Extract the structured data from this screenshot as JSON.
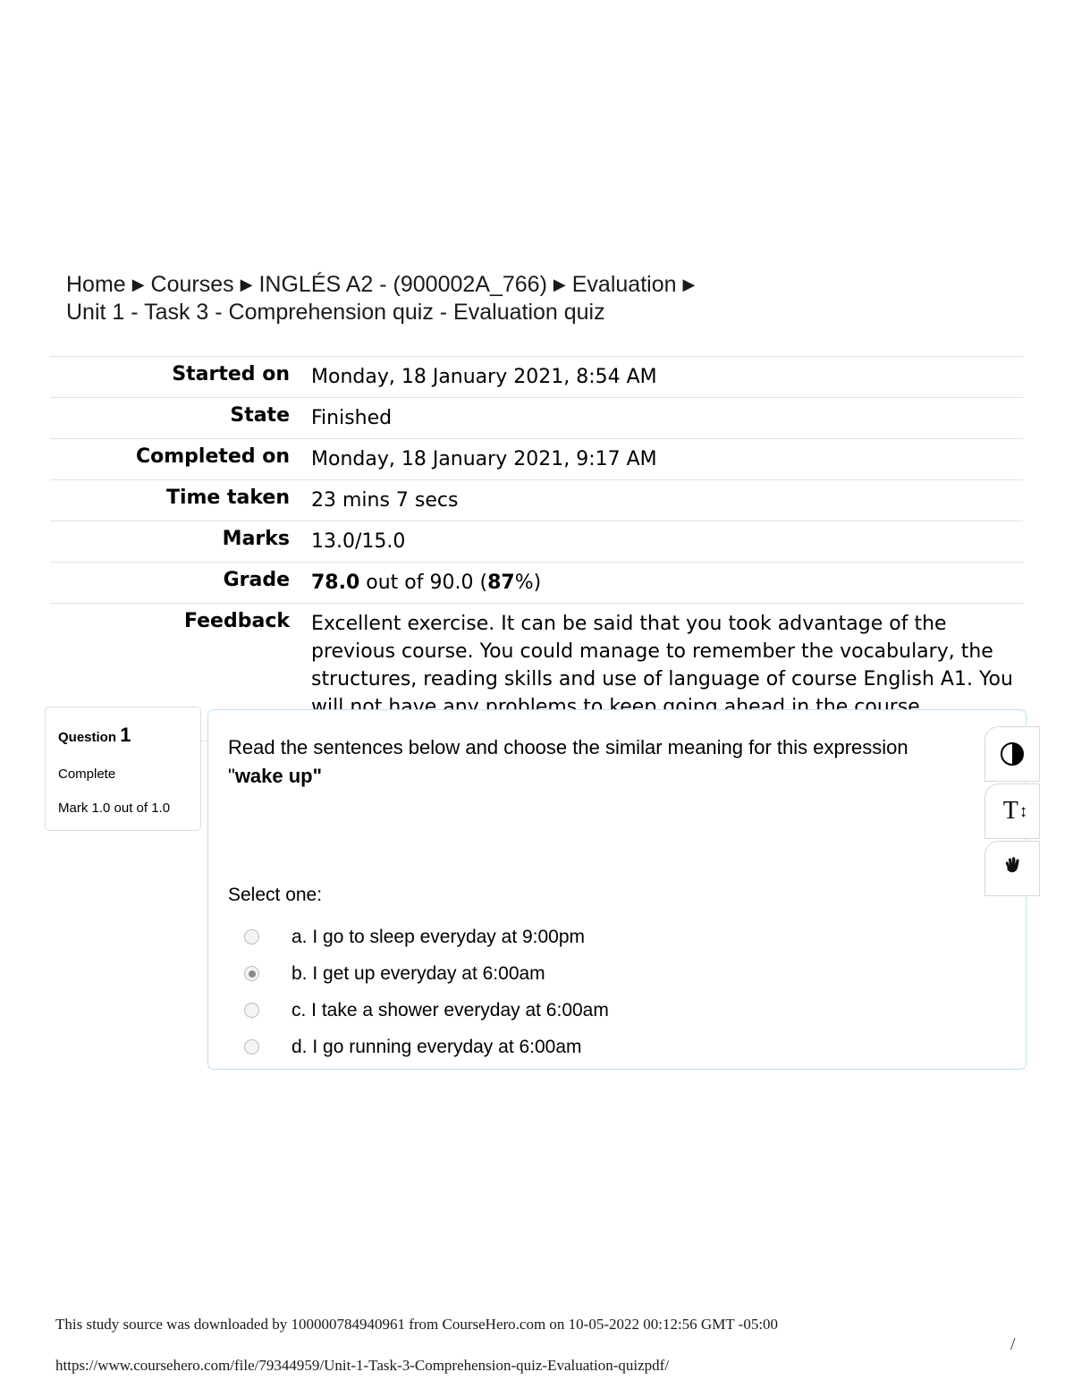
{
  "breadcrumb": {
    "separator": "▶",
    "items": [
      "Home",
      "Courses",
      "INGLÉS A2 - (900002A_766)",
      "Evaluation",
      "Unit 1 - Task 3 - Comprehension quiz - Evaluation quiz"
    ]
  },
  "summary": {
    "rows": [
      {
        "label": "Started on",
        "value": "Monday, 18 January 2021, 8:54 AM"
      },
      {
        "label": "State",
        "value": "Finished"
      },
      {
        "label": "Completed on",
        "value": "Monday, 18 January 2021, 9:17 AM"
      },
      {
        "label": "Time taken",
        "value": "23 mins 7 secs"
      },
      {
        "label": "Marks",
        "value": "13.0/15.0"
      }
    ],
    "grade": {
      "label": "Grade",
      "score": "78.0",
      "middle": " out of 90.0 (",
      "percent": "87",
      "suffix": "%)"
    },
    "feedback": {
      "label": "Feedback",
      "value": "Excellent exercise. It can be said that you took advantage of the previous course. You could manage to remember the vocabulary, the structures, reading skills and use of language of course English A1. You will not have any problems to keep going ahead in the course"
    }
  },
  "question": {
    "info": {
      "title": "Question",
      "number": "1",
      "state": "Complete",
      "mark": "Mark 1.0 out of 1.0"
    },
    "prompt_prefix": "Read the sentences below and choose the similar meaning for this expression \"",
    "prompt_bold": "wake up\"",
    "select_one_label": "Select one:",
    "options": [
      {
        "label": "a. I go to sleep everyday at 9:00pm",
        "selected": false
      },
      {
        "label": "b. I get up everyday at 6:00am",
        "selected": true
      },
      {
        "label": "c. I take a shower everyday at 6:00am",
        "selected": false
      },
      {
        "label": "d. I go running everyday at 6:00am",
        "selected": false
      }
    ],
    "border_color": "#bde3ef"
  },
  "accessibility_toolbar": {
    "buttons": [
      {
        "name": "contrast-icon",
        "glyph": "◑"
      },
      {
        "name": "text-size-icon",
        "glyph": "T",
        "arrows": "↕"
      },
      {
        "name": "sign-language-icon",
        "glyph": "✋"
      }
    ]
  },
  "footer": {
    "note": "This study source was downloaded by 100000784940961 from CourseHero.com on 10-05-2022 00:12:56 GMT -05:00",
    "url": "https://www.coursehero.com/file/79344959/Unit-1-Task-3-Comprehension-quiz-Evaluation-quizpdf/",
    "page_mark": "/"
  }
}
